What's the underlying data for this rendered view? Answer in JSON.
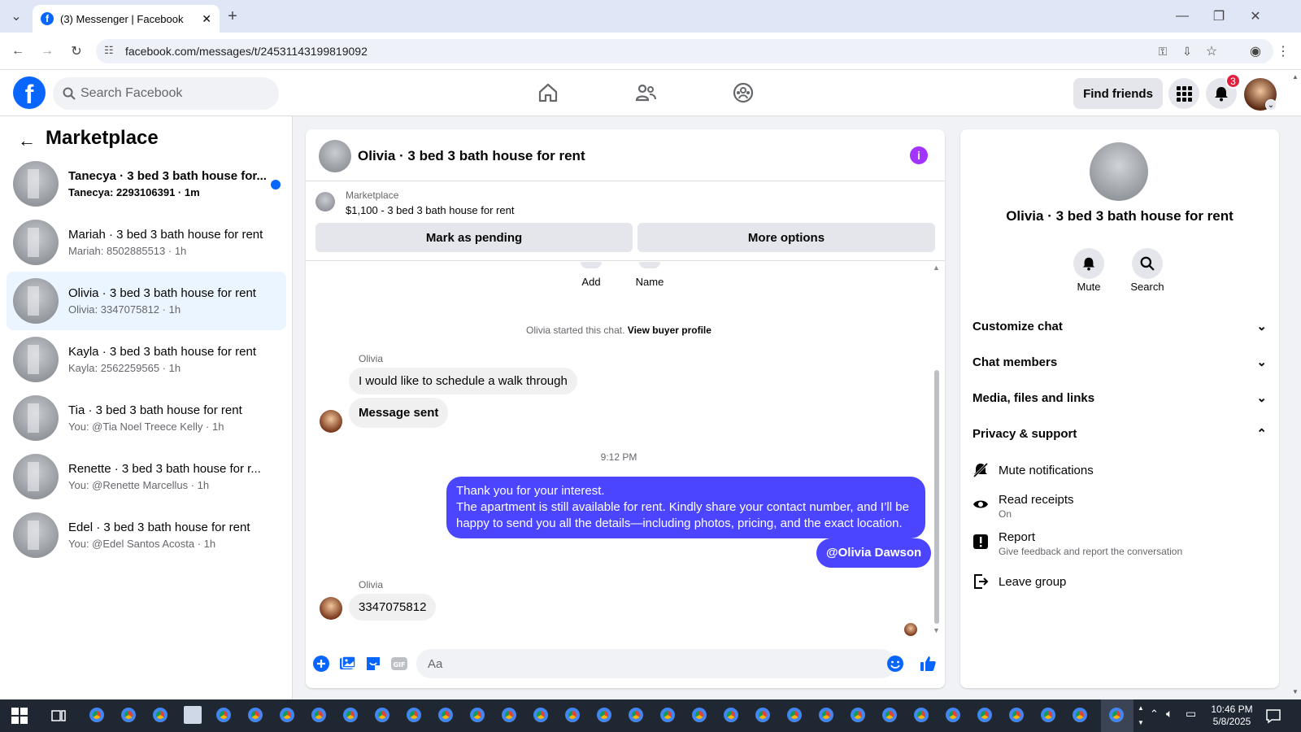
{
  "browser": {
    "tab_title": "(3) Messenger | Facebook",
    "url": "facebook.com/messages/t/24531143199819092"
  },
  "fb": {
    "search_placeholder": "Search Facebook",
    "find_friends": "Find friends",
    "notification_count": "3"
  },
  "sidebar": {
    "title": "Marketplace",
    "conversations": [
      {
        "name": "Tanecya · 3 bed 3 bath house for...",
        "sub": "Tanecya: 2293106391 · 1m"
      },
      {
        "name": "Mariah · 3 bed 3 bath house for rent",
        "sub": "Mariah: 8502885513 · 1h"
      },
      {
        "name": "Olivia · 3 bed 3 bath house for rent",
        "sub": "Olivia: 3347075812 · 1h"
      },
      {
        "name": "Kayla · 3 bed 3 bath house for rent",
        "sub": "Kayla: 2562259565 · 1h"
      },
      {
        "name": "Tia · 3 bed 3 bath house for rent",
        "sub": "You: @Tia Noel Treece Kelly · 1h"
      },
      {
        "name": "Renette · 3 bed 3 bath house for r...",
        "sub": "You: @Renette Marcellus · 1h"
      },
      {
        "name": "Edel · 3 bed 3 bath house for rent",
        "sub": "You: @Edel Santos Acosta · 1h"
      }
    ]
  },
  "chat": {
    "title": "Olivia · 3 bed 3 bath house for rent",
    "marketplace_label": "Marketplace",
    "listing": "$1,100 - 3 bed 3 bath house for rent",
    "mark_pending": "Mark as pending",
    "more_options": "More options",
    "add_label": "Add",
    "name_label": "Name",
    "started_text": "Olivia started this chat.",
    "view_profile": "View buyer profile",
    "sender1": "Olivia",
    "msg1": "I would like to schedule a walk through",
    "msg2": "Message sent",
    "time": "9:12 PM",
    "out_line1": "Thank you for your interest.",
    "out_line2": "The apartment is still available for rent. Kindly share your contact number, and I’ll be",
    "out_line3": "happy to send you all the details—including photos, pricing, and the exact location.",
    "mention": "@Olivia Dawson",
    "sender2": "Olivia",
    "msg3": "3347075812",
    "composer_placeholder": "Aa"
  },
  "rpanel": {
    "name": "Olivia · 3 bed 3 bath house for rent",
    "mute": "Mute",
    "search": "Search",
    "sections": [
      "Customize chat",
      "Chat members",
      "Media, files and links",
      "Privacy & support"
    ],
    "mute_notifications": "Mute notifications",
    "read_receipts": "Read receipts",
    "read_receipts_state": "On",
    "report": "Report",
    "report_sub": "Give feedback and report the conversation",
    "leave_group": "Leave group"
  },
  "taskbar": {
    "time": "10:46 PM",
    "date": "5/8/2025"
  },
  "colors": {
    "fb_blue": "#0866ff",
    "outgoing_bubble": "#4b45ff",
    "info_purple": "#a333ff",
    "badge_red": "#e41e3f"
  }
}
